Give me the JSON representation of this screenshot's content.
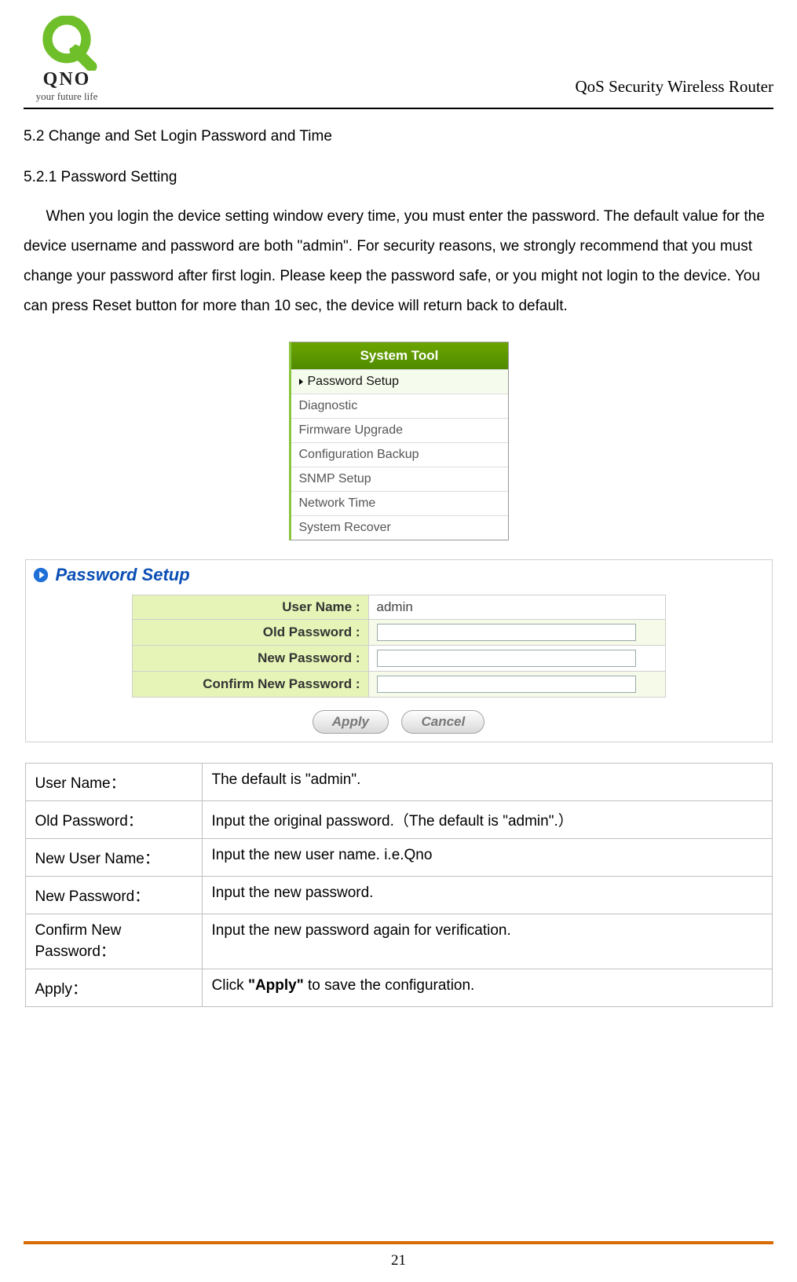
{
  "header": {
    "brand_name": "QNO",
    "tagline": "your future life",
    "doc_title": "QoS Security Wireless Router"
  },
  "section_heading": "5.2 Change and Set Login Password and Time",
  "subsection_heading": "5.2.1 Password Setting",
  "intro_paragraph": "When you login the device setting window every time, you must enter the password. The default value for the device username and password are both \"admin\". For security reasons, we strongly recommend that you must change your password after first login. Please keep the password safe, or you might not login to the device. You can press Reset button for more than 10 sec, the device will return back to default.",
  "system_tool_menu": {
    "title": "System Tool",
    "items": [
      {
        "label": "Password Setup",
        "active": true
      },
      {
        "label": "Diagnostic",
        "active": false
      },
      {
        "label": "Firmware Upgrade",
        "active": false
      },
      {
        "label": "Configuration Backup",
        "active": false
      },
      {
        "label": "SNMP Setup",
        "active": false
      },
      {
        "label": "Network Time",
        "active": false
      },
      {
        "label": "System Recover",
        "active": false
      }
    ]
  },
  "setup_panel": {
    "title": "Password Setup",
    "fields": {
      "user_name": {
        "label": "User Name :",
        "value": "admin"
      },
      "old_password": {
        "label": "Old Password :",
        "value": ""
      },
      "new_password": {
        "label": "New Password :",
        "value": ""
      },
      "confirm_new_password": {
        "label": "Confirm New Password :",
        "value": ""
      }
    },
    "buttons": {
      "apply": "Apply",
      "cancel": "Cancel"
    }
  },
  "description_table": {
    "rows": [
      {
        "label": "User Name：",
        "desc_pre": "The default is \"admin\".",
        "desc_bold": "",
        "desc_post": ""
      },
      {
        "label": "Old Password：",
        "desc_pre": "Input the original password.（The default is \"admin\".）",
        "desc_bold": "",
        "desc_post": ""
      },
      {
        "label": "New User Name：",
        "desc_pre": "Input the new user name. i.e.Qno",
        "desc_bold": "",
        "desc_post": ""
      },
      {
        "label": "New Password：",
        "desc_pre": "Input the new password.",
        "desc_bold": "",
        "desc_post": ""
      },
      {
        "label": "Confirm New Password：",
        "desc_pre": "Input the new password again for verification.",
        "desc_bold": "",
        "desc_post": ""
      },
      {
        "label": "Apply：",
        "desc_pre": "Click ",
        "desc_bold": "\"Apply\"",
        "desc_post": " to save the configuration."
      }
    ]
  },
  "page_number": "21"
}
